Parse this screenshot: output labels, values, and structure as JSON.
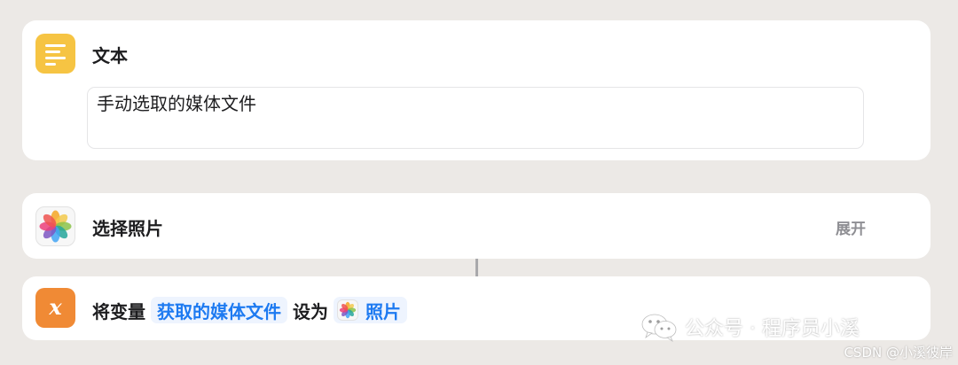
{
  "text_action": {
    "icon": "notes-icon",
    "title": "文本",
    "content": "手动选取的媒体文件",
    "accent": "#f6c443"
  },
  "select_photos_action": {
    "icon": "photos-icon",
    "title": "选择照片",
    "expand_label": "展开"
  },
  "set_variable_action": {
    "icon": "variable-x-icon",
    "icon_letter": "x",
    "prefix": "将变量",
    "variable_name": "获取的媒体文件",
    "middle": "设为",
    "target_icon": "photos-icon",
    "target": "照片",
    "accent": "#f08a35",
    "chip_color": "#1d7af1"
  },
  "watermark": {
    "icon": "wechat-icon",
    "text": "公众号 · 程序员小溪",
    "csdn": "CSDN @小溪彼岸"
  }
}
